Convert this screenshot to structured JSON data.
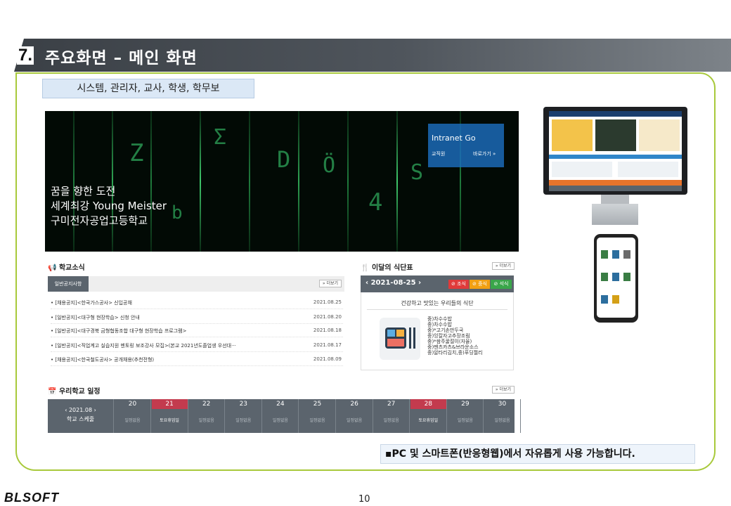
{
  "header": {
    "number": "7.",
    "title": "주요화면 – 메인 화면"
  },
  "roles": "시스템, 관리자, 교사, 학생, 학무보",
  "hero": {
    "line1": "꿈을 향한 도전",
    "line2": "세계최강 Young Meister",
    "line3": "구미전자공업고등학교",
    "intranet_title": "Intranet Go",
    "intranet_staff": "교직원",
    "intranet_link": "바로가기 »"
  },
  "news": {
    "title": "학교소식",
    "tab": "일반공지사항",
    "more": "» 더보기",
    "rows": [
      {
        "text": "• [채용공지]<한국가스공사> 신입공채",
        "date": "2021.08.25"
      },
      {
        "text": "• [일반공지]<대구형 현장학습> 신청 안내",
        "date": "2021.08.20"
      },
      {
        "text": "• [일반공지]<대구경북 금형협동조합 대구형 현장학습 프로그램>",
        "date": "2021.08.18"
      },
      {
        "text": "• [일반공지]<직업계고 실습지원 멘토링 보조강사 모집>(본교 2021년도졸업생 우선대···",
        "date": "2021.08.17"
      },
      {
        "text": "• [채용공지]<한국철도공사> 공개채용(추천전형)",
        "date": "2021.08.09"
      }
    ]
  },
  "meal": {
    "title": "이달의 식단표",
    "more": "» 더보기",
    "date": "‹  2021-08-25  ›",
    "tags": [
      "⊘ 조식",
      "⊘ 중식",
      "⊘ 석식"
    ],
    "subtitle": "건강하고 맛있는 우리들의 식단",
    "items": [
      "중)차수수밥",
      "중)차수수밥",
      "중)*고기손만두국",
      "중)잉칼자고추장조림",
      "중)*쌈주꿀절이(자율)",
      "중)멘츠카츠&브라운소스",
      "중)알타리김치,중)푸딩젤리"
    ],
    "colors": {
      "breakfast": "#e03a3a",
      "lunch": "#f2a012",
      "dinner": "#3aa64a"
    }
  },
  "schedule": {
    "title": "우리학교 일정",
    "more": "» 더보기",
    "month": "‹ 2021.08 ›",
    "label": "학교 스케줄",
    "days": [
      {
        "day": "20",
        "event": "일정없음",
        "holiday": false
      },
      {
        "day": "21",
        "event": "토요휴업일",
        "holiday": true
      },
      {
        "day": "22",
        "event": "일정없음",
        "holiday": false
      },
      {
        "day": "23",
        "event": "일정없음",
        "holiday": false
      },
      {
        "day": "24",
        "event": "일정없음",
        "holiday": false
      },
      {
        "day": "25",
        "event": "일정없음",
        "holiday": false
      },
      {
        "day": "26",
        "event": "일정없음",
        "holiday": false
      },
      {
        "day": "27",
        "event": "일정없음",
        "holiday": false
      },
      {
        "day": "28",
        "event": "토요휴업일",
        "holiday": true
      },
      {
        "day": "29",
        "event": "일정없음",
        "holiday": false
      },
      {
        "day": "30",
        "event": "일정없음",
        "holiday": false
      }
    ]
  },
  "caption": "▪PC 및 스마트폰(반응형웹)에서 자유롭게 사용 가능합니다.",
  "footer": {
    "logo": "BLSOFT",
    "page": "10"
  },
  "accent": {
    "frame": "#a8c93b",
    "header": "#4f555c",
    "holiday": "#c33b4e"
  }
}
